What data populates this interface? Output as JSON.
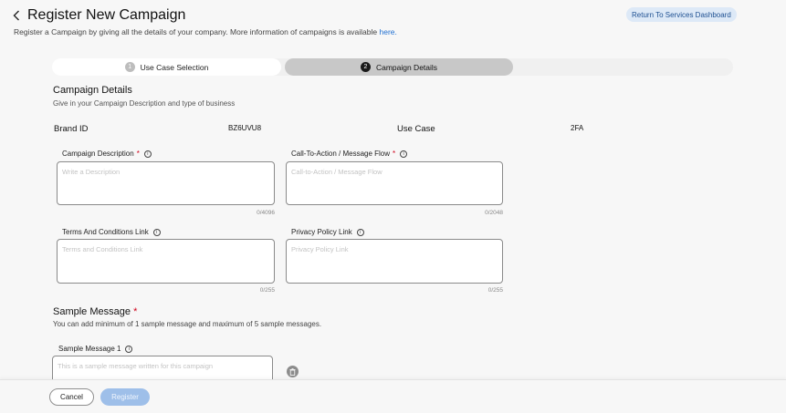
{
  "header": {
    "title": "Register New Campaign",
    "subtitle": "Register a Campaign by giving all the details of your company. More information of campaigns is available ",
    "subtitle_link": "here.",
    "return_button": "Return To Services Dashboard"
  },
  "stepper": {
    "steps": [
      {
        "number": "1",
        "label": "Use Case Selection"
      },
      {
        "number": "2",
        "label": "Campaign Details"
      }
    ]
  },
  "campaign_details": {
    "title": "Campaign Details",
    "subtitle": "Give in your Campaign Description and type of business",
    "brand_id_label": "Brand ID",
    "brand_id_value": "BZ6UVU8",
    "use_case_label": "Use Case",
    "use_case_value": "2FA"
  },
  "fields": {
    "description": {
      "label": "Campaign Description",
      "required": "*",
      "placeholder": "Write a Description",
      "counter": "0/4096"
    },
    "cta": {
      "label": "Call-To-Action / Message Flow",
      "required": "*",
      "placeholder": "Call-to-Action / Message Flow",
      "counter": "0/2048"
    },
    "terms": {
      "label": "Terms And Conditions Link",
      "placeholder": "Terms and Conditions Link",
      "counter": "0/255"
    },
    "privacy": {
      "label": "Privacy Policy Link",
      "placeholder": "Privacy Policy Link",
      "counter": "0/255"
    }
  },
  "sample": {
    "title": "Sample Message",
    "required": "*",
    "subtitle": "You can add minimum of 1 sample message and maximum of 5 sample messages.",
    "message1_label": "Sample Message 1",
    "message1_placeholder": "This is a sample message written for this campaign"
  },
  "footer": {
    "cancel": "Cancel",
    "register": "Register"
  },
  "colors": {
    "accent": "#1f6fd1",
    "register_disabled": "#9ebfe9",
    "required": "#d0021b"
  },
  "icons": {
    "back": "chevron-left-icon",
    "info": "info-icon",
    "delete": "trash-icon"
  }
}
